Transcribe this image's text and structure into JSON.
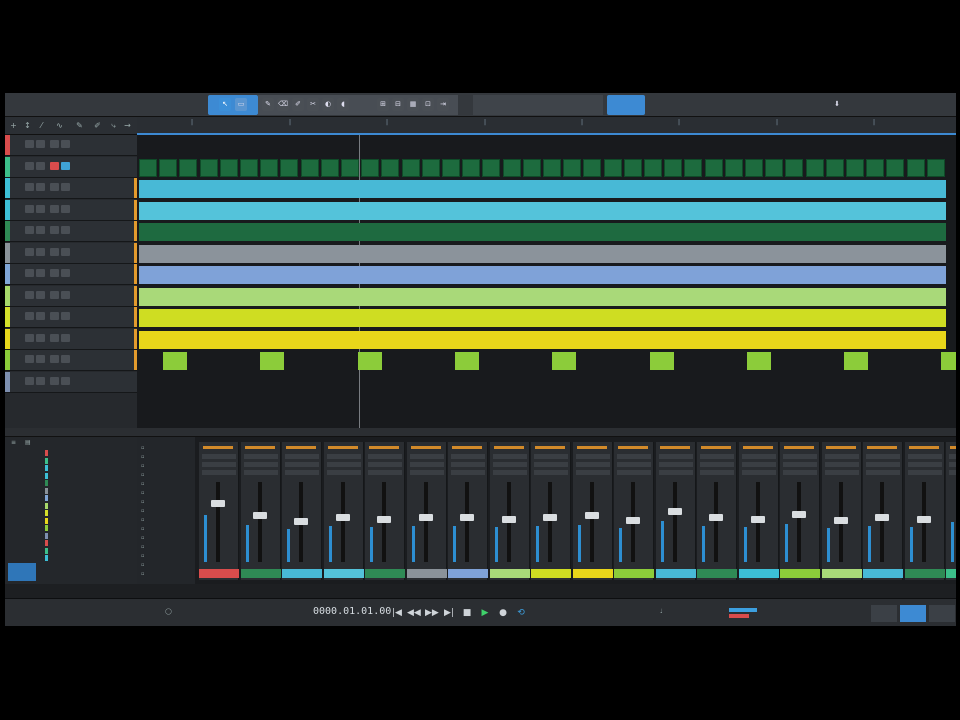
{
  "toolbar": {
    "left_labels": [
      "",
      ""
    ],
    "right_labels": [
      "",
      "",
      ""
    ]
  },
  "tracks": [
    {
      "name": "",
      "color": "#d94c4c",
      "vol": "",
      "lane_color": "#111316"
    },
    {
      "name": "",
      "color": "#3cbf8a",
      "vol": "",
      "lane_color": "#1d6b3e"
    },
    {
      "name": "",
      "color": "#3cbfd6",
      "vol": "",
      "lane_color": "#48b9d6"
    },
    {
      "name": "",
      "color": "#3cbfd6",
      "vol": "",
      "lane_color": "#54c3da"
    },
    {
      "name": "",
      "color": "#2f8a55",
      "vol": "",
      "lane_color": "#1e6a40"
    },
    {
      "name": "",
      "color": "#8a9299",
      "vol": "",
      "lane_color": "#8b939b"
    },
    {
      "name": "",
      "color": "#7fa5d6",
      "vol": "",
      "lane_color": "#7fa2d8"
    },
    {
      "name": "",
      "color": "#a7d86a",
      "vol": "",
      "lane_color": "#a9d979"
    },
    {
      "name": "",
      "color": "#d4e02a",
      "vol": "",
      "lane_color": "#cfdd22"
    },
    {
      "name": "",
      "color": "#e8d81b",
      "vol": "",
      "lane_color": "#e9d61a"
    },
    {
      "name": "",
      "color": "#8ccc3a",
      "vol": "",
      "lane_color": "#141618"
    },
    {
      "name": "",
      "color": "#7d8fb0",
      "vol": "",
      "lane_color": "#1b1d20"
    }
  ],
  "mixer": {
    "strip_labels": [
      "",
      "",
      "",
      "",
      "",
      "",
      "",
      "",
      "",
      "",
      "",
      "",
      "",
      "",
      "",
      "",
      "",
      "",
      ""
    ],
    "strip_colors": [
      "#d94c4c",
      "#2f8a55",
      "#48b9d6",
      "#54c3da",
      "#2f8a55",
      "#8a9299",
      "#7fa2d8",
      "#a9d979",
      "#cfdd22",
      "#e9d61a",
      "#8ccc3a",
      "#48b9d6",
      "#2f8a55",
      "#3cbfd6",
      "#8ccc3a",
      "#a9d979",
      "#48b9d6",
      "#2f8a55",
      "#3cbf8a"
    ],
    "fader_levels": [
      0.78,
      0.62,
      0.55,
      0.6,
      0.58,
      0.6,
      0.6,
      0.58,
      0.6,
      0.62,
      0.56,
      0.68,
      0.6,
      0.58,
      0.64,
      0.56,
      0.6,
      0.58,
      0.66
    ]
  },
  "transport": {
    "time_display": "0000.01.01.00",
    "buttons": [
      "◀◀",
      "■",
      "▶",
      "●"
    ]
  },
  "icons": [
    "arrow-tool-icon",
    "range-tool-icon",
    "pencil-tool-icon",
    "eraser-tool-icon",
    "scissors-icon",
    "mute-tool-icon",
    "zoom-icon",
    "play-icon",
    "stop-icon",
    "record-icon",
    "rewind-icon",
    "loop-icon"
  ]
}
